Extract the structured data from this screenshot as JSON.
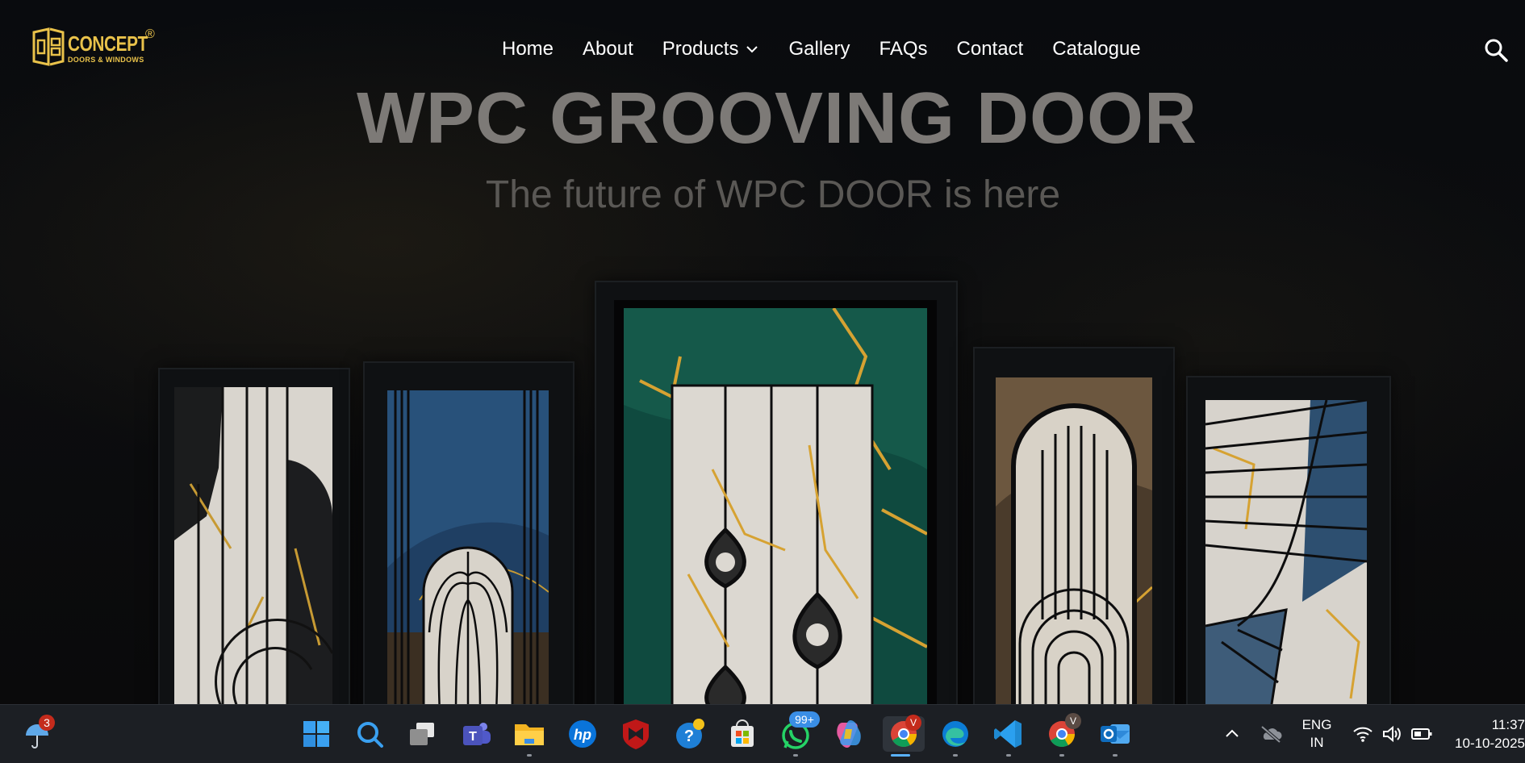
{
  "logo": {
    "brand": "CONCEPT",
    "reg": "®",
    "tagline": "DOORS & WINDOWS"
  },
  "nav": {
    "items": [
      {
        "label": "Home"
      },
      {
        "label": "About"
      },
      {
        "label": "Products"
      },
      {
        "label": "Gallery"
      },
      {
        "label": "FAQs"
      },
      {
        "label": "Contact"
      },
      {
        "label": "Catalogue"
      }
    ]
  },
  "hero": {
    "title": "WPC GROOVING DOOR",
    "subtitle": "The future of WPC DOOR is here"
  },
  "taskbar": {
    "weather_badge": "3",
    "whatsapp_badge": "99+",
    "chrome_badge": "V",
    "chrome2_badge": "V",
    "lang_line1": "ENG",
    "lang_line2": "IN",
    "time": "11:37",
    "date": "10-10-2025"
  },
  "colors": {
    "logo_gold": "#e9c24a",
    "hero_title": "#7d7a77",
    "hero_subtitle": "#5a5855",
    "taskbar": "#1c1f24",
    "active_indicator": "#5ab2ff"
  }
}
